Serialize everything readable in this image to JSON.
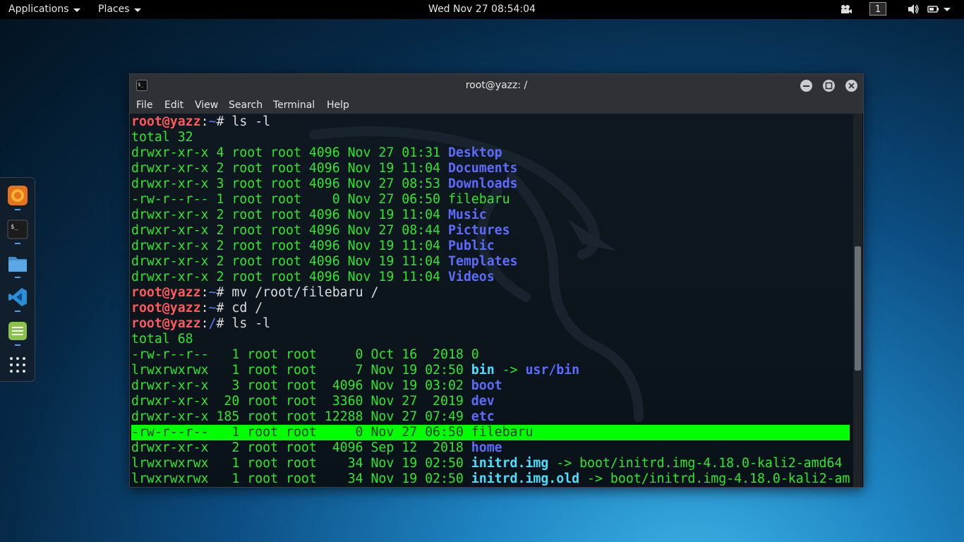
{
  "topbar": {
    "applications": "Applications",
    "places": "Places",
    "clock": "Wed Nov 27  08:54:04",
    "workspace": "1"
  },
  "dock": {
    "items": [
      "firefox-icon",
      "terminal-icon",
      "files-icon",
      "vscode-icon",
      "notes-icon",
      "show-apps-icon"
    ]
  },
  "window": {
    "title": "root@yazz: /",
    "menus": [
      "File",
      "Edit",
      "View",
      "Search",
      "Terminal",
      "Help"
    ]
  },
  "terminal": {
    "prompt_user": "root@yazz",
    "cmd1": "ls -l",
    "total1": "total 32",
    "home_listing": [
      {
        "perm": "drwxr-xr-x 4 root root 4096 Nov 27 01:31 ",
        "name": "Desktop"
      },
      {
        "perm": "drwxr-xr-x 2 root root 4096 Nov 19 11:04 ",
        "name": "Documents"
      },
      {
        "perm": "drwxr-xr-x 3 root root 4096 Nov 27 08:53 ",
        "name": "Downloads"
      },
      {
        "perm": "-rw-r--r-- 1 root root    0 Nov 27 06:50 ",
        "name": "filebaru"
      },
      {
        "perm": "drwxr-xr-x 2 root root 4096 Nov 19 11:04 ",
        "name": "Music"
      },
      {
        "perm": "drwxr-xr-x 2 root root 4096 Nov 27 08:44 ",
        "name": "Pictures"
      },
      {
        "perm": "drwxr-xr-x 2 root root 4096 Nov 19 11:04 ",
        "name": "Public"
      },
      {
        "perm": "drwxr-xr-x 2 root root 4096 Nov 19 11:04 ",
        "name": "Templates"
      },
      {
        "perm": "drwxr-xr-x 2 root root 4096 Nov 19 11:04 ",
        "name": "Videos"
      }
    ],
    "cmd2": "mv /root/filebaru /",
    "cmd3": "cd /",
    "cmd4": "ls -l",
    "total2": "total 68",
    "root_listing": [
      {
        "perm": "-rw-r--r--   1 root root     0 Oct 16  2018 ",
        "name": "0"
      },
      {
        "perm": "lrwxrwxrwx   1 root root     7 Nov 19 02:50 ",
        "name": "bin",
        "target": "usr/bin"
      },
      {
        "perm": "drwxr-xr-x   3 root root  4096 Nov 19 03:02 ",
        "name": "boot"
      },
      {
        "perm": "drwxr-xr-x  20 root root  3360 Nov 27  2019 ",
        "name": "dev"
      },
      {
        "perm": "drwxr-xr-x 185 root root 12288 Nov 27 07:49 ",
        "name": "etc"
      },
      {
        "perm": "-rw-r--r--   1 root root     0 Nov 27 06:50 ",
        "name": "filebaru"
      },
      {
        "perm": "drwxr-xr-x   2 root root  4096 Sep 12  2018 ",
        "name": "home"
      },
      {
        "perm": "lrwxrwxrwx   1 root root    34 Nov 19 02:50 ",
        "name": "initrd.img",
        "target": "boot/initrd.img-4.18.0-kali2-amd64"
      },
      {
        "perm": "lrwxrwxrwx   1 root root    34 Nov 19 02:50 ",
        "name": "initrd.img.old",
        "target": "boot/initrd.img-4.18.0-kali2-am"
      }
    ]
  }
}
